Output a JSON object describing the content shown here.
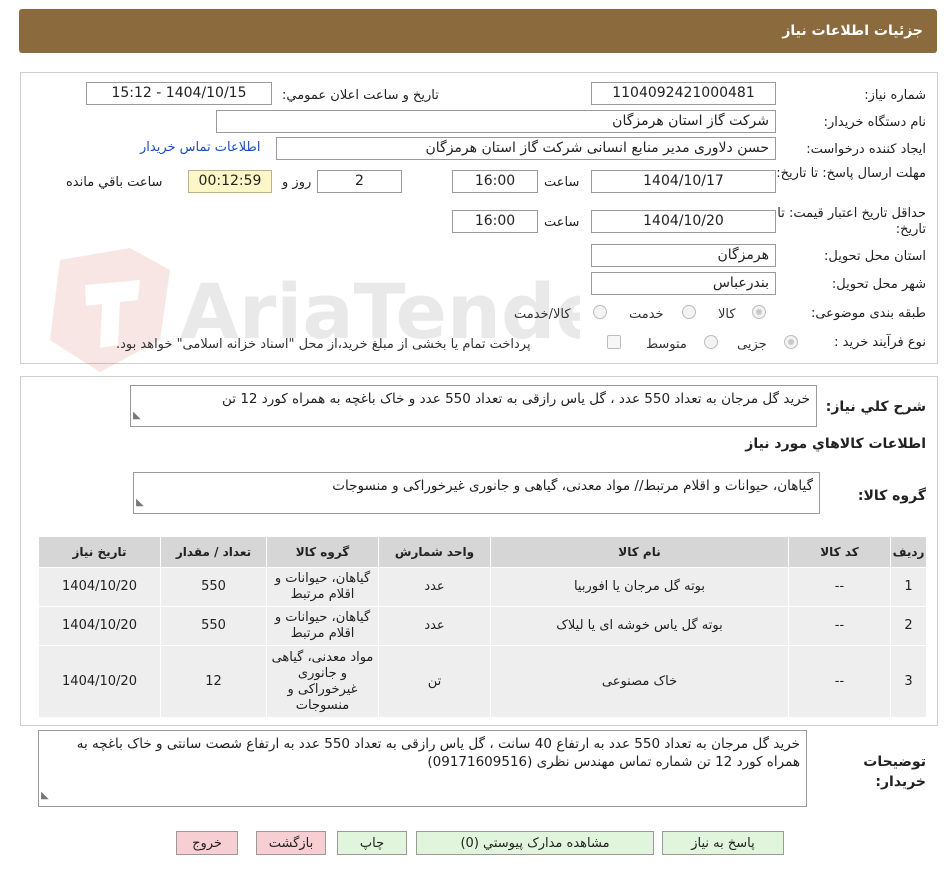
{
  "header": {
    "title": "جزئیات اطلاعات نیاز"
  },
  "form": {
    "need_number_label": "شماره نیاز:",
    "need_number": "1104092421000481",
    "announce_label": "تاریخ و ساعت اعلان عمومي:",
    "announce_value": "1404/10/15 - 15:12",
    "buyer_org_label": "نام دستگاه خریدار:",
    "buyer_org": "شرکت گاز استان هرمزگان",
    "creator_label": "ایجاد کننده درخواست:",
    "creator": "حسن دلاوری مدیر منابع انسانی شرکت گاز استان هرمزگان",
    "contact_link": "اطلاعات تماس خریدار",
    "reply_deadline_label": "مهلت ارسال پاسخ: تا تاریخ:",
    "reply_date": "1404/10/17",
    "hour_label": "ساعت",
    "reply_time": "16:00",
    "days_value": "2",
    "days_label": "روز و",
    "remaining_time": "00:12:59",
    "remaining_label": "ساعت باقي مانده",
    "price_validity_label": "حداقل تاریخ اعتبار قیمت: تا تاریخ:",
    "price_date": "1404/10/20",
    "price_time": "16:00",
    "province_label": "استان محل تحویل:",
    "province": "هرمزگان",
    "city_label": "شهر محل تحویل:",
    "city": "بندرعباس",
    "category_label": "طبقه بندی موضوعی:",
    "category_options": [
      "کالا",
      "خدمت",
      "کالا/خدمت"
    ],
    "process_label": "نوع فرآیند خرید :",
    "process_options": [
      "جزیی",
      "متوسط"
    ],
    "process_note": "پرداخت تمام یا بخشی از مبلغ خرید،از محل \"اسناد خزانه اسلامی\" خواهد بود."
  },
  "description": {
    "label": "شرح کلي نیاز:",
    "text": "خرید گل مرجان به تعداد 550 عدد ، گل یاس رازقی به تعداد 550 عدد و خاک باغچه به همراه کورد 12 تن"
  },
  "goods": {
    "section_title": "اطلاعات کالاهاي مورد نیاز",
    "group_label": "گروه کالا:",
    "group_text": "گیاهان، حیوانات و اقلام مرتبط// مواد معدنی، گیاهی و جانوری غیرخوراکی و منسوجات"
  },
  "table": {
    "headers": [
      "ردیف",
      "کد کالا",
      "نام کالا",
      "واحد شمارش",
      "گروه کالا",
      "تعداد / مقدار",
      "تاریخ نیاز"
    ],
    "rows": [
      [
        "1",
        "--",
        "بوته گل مرجان یا افوربیا",
        "عدد",
        "گیاهان، حیوانات و اقلام مرتبط",
        "550",
        "1404/10/20"
      ],
      [
        "2",
        "--",
        "بوته گل یاس خوشه ای یا لیلاک",
        "عدد",
        "گیاهان، حیوانات و اقلام مرتبط",
        "550",
        "1404/10/20"
      ],
      [
        "3",
        "--",
        "خاک مصنوعی",
        "تن",
        "مواد معدنی، گیاهی و جانوری غیرخوراکی و منسوجات",
        "12",
        "1404/10/20"
      ]
    ]
  },
  "buyer_notes": {
    "label": "توضیحات خریدار:",
    "text": "خرید گل مرجان به تعداد 550 عدد به ارتفاع 40 سانت  ، گل یاس رازقی به تعداد 550 عدد به ارتفاع شصت سانتی  و خاک باغچه به همراه کورد 12 تن  شماره تماس مهندس نظری (09171609516)"
  },
  "buttons": {
    "reply": "پاسخ به نیاز",
    "attachments": "مشاهده مدارک پیوستي (0)",
    "print": "چاپ",
    "back": "بازگشت",
    "exit": "خروج"
  },
  "watermark": {
    "text": "AriaTender.neT"
  }
}
